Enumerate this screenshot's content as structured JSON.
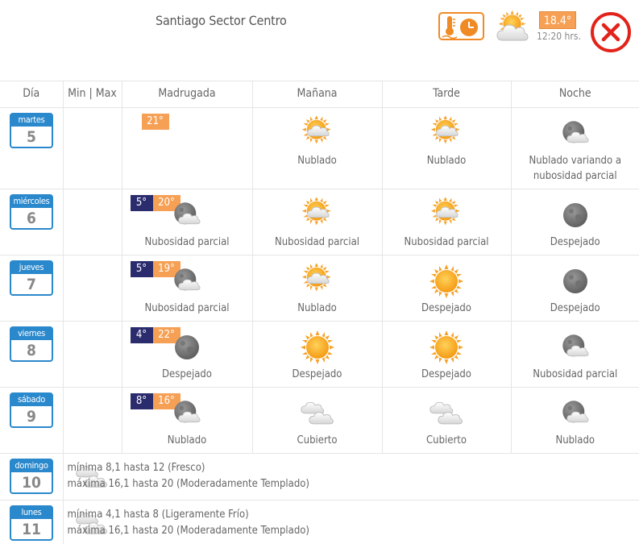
{
  "header": {
    "city": "Santiago Sector Centro",
    "current_temp": "18.4°",
    "current_time": "12:20 hrs.",
    "current_icon": "partly-cloudy-sun-icon",
    "thermometer_button_icon": "thermometer-clock-icon",
    "close_icon": "close-icon"
  },
  "colors": {
    "accent_orange": "#f08a24",
    "max_temp": "#f6a055",
    "min_temp": "#2b2c6e",
    "day_blue": "#2a88cc",
    "close_red": "#e2231a"
  },
  "columns": [
    "Día",
    "Min | Max",
    "Madrugada",
    "Mañana",
    "Tarde",
    "Noche"
  ],
  "days": [
    {
      "name": "martes",
      "num": "5",
      "min": "",
      "max": "21°",
      "periods": [
        null,
        {
          "icon": "sun-cloud-icon",
          "label": "Nublado"
        },
        {
          "icon": "sun-cloud-icon",
          "label": "Nublado"
        },
        {
          "icon": "moon-cloud-icon",
          "label": "Nublado variando a nubosidad parcial"
        }
      ]
    },
    {
      "name": "miércoles",
      "num": "6",
      "min": "5°",
      "max": "20°",
      "periods": [
        {
          "icon": "moon-cloud-icon",
          "label": "Nubosidad parcial"
        },
        {
          "icon": "sun-cloud-icon",
          "label": "Nubosidad parcial"
        },
        {
          "icon": "sun-cloud-icon",
          "label": "Nubosidad parcial"
        },
        {
          "icon": "moon-icon",
          "label": "Despejado"
        }
      ]
    },
    {
      "name": "jueves",
      "num": "7",
      "min": "5°",
      "max": "19°",
      "periods": [
        {
          "icon": "moon-cloud-icon",
          "label": "Nubosidad parcial"
        },
        {
          "icon": "sun-cloud-icon",
          "label": "Nublado"
        },
        {
          "icon": "sun-icon",
          "label": "Despejado"
        },
        {
          "icon": "moon-icon",
          "label": "Despejado"
        }
      ]
    },
    {
      "name": "viernes",
      "num": "8",
      "min": "4°",
      "max": "22°",
      "periods": [
        {
          "icon": "moon-icon",
          "label": "Despejado"
        },
        {
          "icon": "sun-icon",
          "label": "Despejado"
        },
        {
          "icon": "sun-icon",
          "label": "Despejado"
        },
        {
          "icon": "moon-cloud-icon",
          "label": "Nubosidad parcial"
        }
      ]
    },
    {
      "name": "sábado",
      "num": "9",
      "min": "8°",
      "max": "16°",
      "periods": [
        {
          "icon": "moon-cloud-icon",
          "label": "Nublado"
        },
        {
          "icon": "clouds-icon",
          "label": "Cubierto"
        },
        {
          "icon": "clouds-icon",
          "label": "Cubierto"
        },
        {
          "icon": "moon-cloud-icon",
          "label": "Nublado"
        }
      ]
    }
  ],
  "week": [
    {
      "name": "domingo",
      "num": "10",
      "icon": "clouds-icon",
      "line1": "mínima 8,1 hasta 12 (Fresco)",
      "line2": "máxima 16,1 hasta 20 (Moderadamente Templado)"
    },
    {
      "name": "lunes",
      "num": "11",
      "icon": "clouds-icon",
      "line1": "mínima 4,1 hasta 8 (Ligeramente Frío)",
      "line2": "máxima 16,1 hasta 20 (Moderadamente Templado)"
    }
  ]
}
